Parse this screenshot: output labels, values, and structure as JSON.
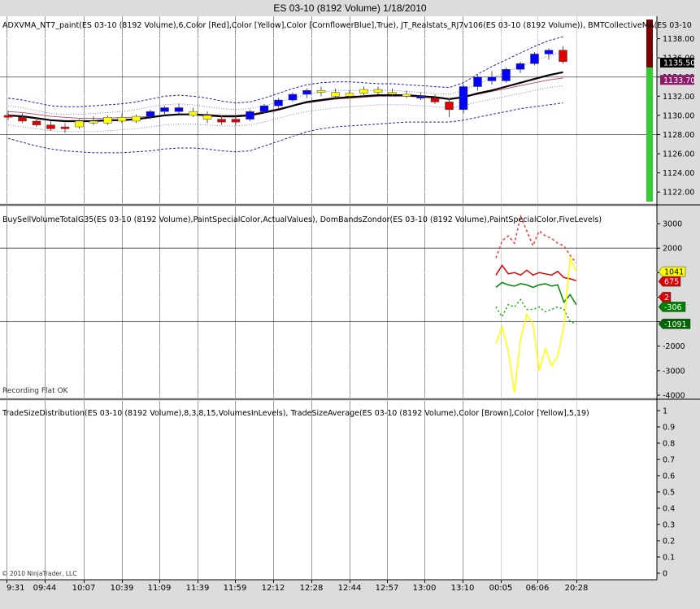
{
  "window": {
    "title": "ES 03-10 (8192 Volume)  1/18/2010"
  },
  "chart_data": [
    {
      "type": "candlestick",
      "panel": "price",
      "label": "ADXVMA_NT7_paint(ES 03-10 (8192 Volume),6,Color [Red],Color [Yellow],Color [CornflowerBlue],True), JT_Realstats_RJ7v106(ES 03-10 (8192 Volume)), BMTCollectiveMA(ES 03-10",
      "ylim": [
        1121,
        1140
      ],
      "yticks": [
        "1138.00",
        "1136.00",
        "1134.00",
        "1132.00",
        "1130.00",
        "1128.00",
        "1126.00",
        "1124.00",
        "1122.00"
      ],
      "price_tags": [
        {
          "text": "1135.50",
          "value": 1135.5,
          "bg": "#000000",
          "fg": "#ffffff"
        },
        {
          "text": "1133.70",
          "value": 1133.7,
          "bg": "#8b1a6b",
          "fg": "#ffffff"
        }
      ],
      "corner_value": "0",
      "candles": [
        {
          "o": 1130.0,
          "h": 1130.5,
          "l": 1129.5,
          "c": 1129.8,
          "color": "red"
        },
        {
          "o": 1129.8,
          "h": 1130.2,
          "l": 1129.2,
          "c": 1129.4,
          "color": "red"
        },
        {
          "o": 1129.4,
          "h": 1129.8,
          "l": 1128.8,
          "c": 1129.0,
          "color": "red"
        },
        {
          "o": 1129.0,
          "h": 1129.4,
          "l": 1128.4,
          "c": 1128.6,
          "color": "red"
        },
        {
          "o": 1128.6,
          "h": 1129.2,
          "l": 1128.2,
          "c": 1128.8,
          "color": "red"
        },
        {
          "o": 1128.8,
          "h": 1129.6,
          "l": 1128.6,
          "c": 1129.4,
          "color": "yellow"
        },
        {
          "o": 1129.4,
          "h": 1129.9,
          "l": 1129.0,
          "c": 1129.2,
          "color": "yellow"
        },
        {
          "o": 1129.2,
          "h": 1130.0,
          "l": 1129.0,
          "c": 1129.8,
          "color": "yellow"
        },
        {
          "o": 1129.8,
          "h": 1130.2,
          "l": 1129.2,
          "c": 1129.4,
          "color": "yellow"
        },
        {
          "o": 1129.4,
          "h": 1130.1,
          "l": 1129.2,
          "c": 1129.9,
          "color": "yellow"
        },
        {
          "o": 1129.9,
          "h": 1130.6,
          "l": 1129.6,
          "c": 1130.4,
          "color": "blue"
        },
        {
          "o": 1130.4,
          "h": 1131.0,
          "l": 1130.0,
          "c": 1130.8,
          "color": "blue"
        },
        {
          "o": 1130.8,
          "h": 1131.2,
          "l": 1130.2,
          "c": 1130.4,
          "color": "blue"
        },
        {
          "o": 1130.4,
          "h": 1130.8,
          "l": 1129.8,
          "c": 1130.0,
          "color": "yellow"
        },
        {
          "o": 1130.0,
          "h": 1130.4,
          "l": 1129.2,
          "c": 1129.6,
          "color": "yellow"
        },
        {
          "o": 1129.6,
          "h": 1130.0,
          "l": 1129.0,
          "c": 1129.3,
          "color": "red"
        },
        {
          "o": 1129.3,
          "h": 1129.9,
          "l": 1129.0,
          "c": 1129.6,
          "color": "red"
        },
        {
          "o": 1129.6,
          "h": 1130.6,
          "l": 1129.4,
          "c": 1130.4,
          "color": "blue"
        },
        {
          "o": 1130.4,
          "h": 1131.2,
          "l": 1130.2,
          "c": 1131.0,
          "color": "blue"
        },
        {
          "o": 1131.0,
          "h": 1131.8,
          "l": 1130.8,
          "c": 1131.6,
          "color": "blue"
        },
        {
          "o": 1131.6,
          "h": 1132.4,
          "l": 1131.4,
          "c": 1132.2,
          "color": "blue"
        },
        {
          "o": 1132.2,
          "h": 1132.8,
          "l": 1131.8,
          "c": 1132.6,
          "color": "blue"
        },
        {
          "o": 1132.6,
          "h": 1133.0,
          "l": 1132.0,
          "c": 1132.4,
          "color": "yellow"
        },
        {
          "o": 1132.4,
          "h": 1132.8,
          "l": 1131.8,
          "c": 1132.0,
          "color": "yellow"
        },
        {
          "o": 1132.0,
          "h": 1132.6,
          "l": 1131.8,
          "c": 1132.3,
          "color": "yellow"
        },
        {
          "o": 1132.3,
          "h": 1133.0,
          "l": 1132.0,
          "c": 1132.7,
          "color": "yellow"
        },
        {
          "o": 1132.7,
          "h": 1133.0,
          "l": 1132.2,
          "c": 1132.4,
          "color": "yellow"
        },
        {
          "o": 1132.4,
          "h": 1132.8,
          "l": 1132.0,
          "c": 1132.2,
          "color": "yellow"
        },
        {
          "o": 1132.2,
          "h": 1132.6,
          "l": 1131.8,
          "c": 1132.0,
          "color": "yellow"
        },
        {
          "o": 1132.0,
          "h": 1132.4,
          "l": 1131.6,
          "c": 1131.8,
          "color": "blue"
        },
        {
          "o": 1131.8,
          "h": 1132.2,
          "l": 1131.2,
          "c": 1131.4,
          "color": "red"
        },
        {
          "o": 1131.4,
          "h": 1131.8,
          "l": 1129.8,
          "c": 1130.6,
          "color": "red"
        },
        {
          "o": 1130.6,
          "h": 1133.2,
          "l": 1130.2,
          "c": 1133.0,
          "color": "blue"
        },
        {
          "o": 1133.0,
          "h": 1134.2,
          "l": 1132.6,
          "c": 1134.0,
          "color": "blue"
        },
        {
          "o": 1134.0,
          "h": 1134.6,
          "l": 1133.2,
          "c": 1133.6,
          "color": "blue"
        },
        {
          "o": 1133.6,
          "h": 1135.0,
          "l": 1133.4,
          "c": 1134.8,
          "color": "blue"
        },
        {
          "o": 1134.8,
          "h": 1135.6,
          "l": 1134.4,
          "c": 1135.4,
          "color": "blue"
        },
        {
          "o": 1135.4,
          "h": 1136.6,
          "l": 1135.2,
          "c": 1136.4,
          "color": "blue"
        },
        {
          "o": 1136.4,
          "h": 1137.0,
          "l": 1135.8,
          "c": 1136.8,
          "color": "blue"
        },
        {
          "o": 1136.8,
          "h": 1137.2,
          "l": 1135.4,
          "c": 1135.6,
          "color": "red"
        }
      ],
      "ma_black": [
        1130.0,
        1129.9,
        1129.7,
        1129.5,
        1129.4,
        1129.4,
        1129.4,
        1129.5,
        1129.5,
        1129.6,
        1129.8,
        1130.0,
        1130.1,
        1130.1,
        1130.0,
        1129.9,
        1129.9,
        1130.0,
        1130.3,
        1130.6,
        1131.0,
        1131.4,
        1131.6,
        1131.8,
        1131.9,
        1132.0,
        1132.1,
        1132.1,
        1132.1,
        1132.0,
        1131.9,
        1131.7,
        1131.9,
        1132.3,
        1132.6,
        1133.0,
        1133.4,
        1133.8,
        1134.2,
        1134.5
      ],
      "ma_red": [
        1130.4,
        1130.3,
        1130.1,
        1129.9,
        1129.8,
        1129.7,
        1129.7,
        1129.7,
        1129.8,
        1129.8,
        1129.9,
        1130.0,
        1130.1,
        1130.1,
        1130.1,
        1130.0,
        1130.0,
        1130.1,
        1130.4,
        1130.7,
        1131.0,
        1131.3,
        1131.5,
        1131.7,
        1131.8,
        1131.9,
        1132.0,
        1132.0,
        1132.0,
        1131.9,
        1131.8,
        1131.7,
        1131.9,
        1132.2,
        1132.5,
        1132.8,
        1133.1,
        1133.4,
        1133.7,
        1133.9
      ],
      "band_upper": [
        1131.8,
        1131.6,
        1131.3,
        1131.0,
        1130.9,
        1130.9,
        1131.0,
        1131.1,
        1131.2,
        1131.4,
        1131.7,
        1132.0,
        1132.1,
        1132.0,
        1131.8,
        1131.5,
        1131.3,
        1131.4,
        1131.8,
        1132.3,
        1132.8,
        1133.2,
        1133.4,
        1133.5,
        1133.5,
        1133.4,
        1133.3,
        1133.3,
        1133.2,
        1133.1,
        1133.0,
        1132.9,
        1133.4,
        1134.3,
        1135.1,
        1135.8,
        1136.5,
        1137.2,
        1137.8,
        1138.2
      ],
      "band_mid_upper": [
        1131.0,
        1130.8,
        1130.5,
        1130.2,
        1130.1,
        1130.1,
        1130.2,
        1130.3,
        1130.4,
        1130.6,
        1130.9,
        1131.1,
        1131.2,
        1131.1,
        1130.9,
        1130.7,
        1130.6,
        1130.7,
        1131.0,
        1131.4,
        1131.8,
        1132.2,
        1132.4,
        1132.6,
        1132.6,
        1132.6,
        1132.6,
        1132.6,
        1132.5,
        1132.4,
        1132.3,
        1132.2,
        1132.6,
        1133.3,
        1133.9,
        1134.5,
        1135.1,
        1135.7,
        1136.2,
        1136.6
      ],
      "band_mid_lower": [
        1129.0,
        1128.8,
        1128.6,
        1128.4,
        1128.3,
        1128.3,
        1128.3,
        1128.4,
        1128.5,
        1128.6,
        1128.8,
        1129.0,
        1129.1,
        1129.1,
        1129.0,
        1128.9,
        1128.9,
        1129.0,
        1129.3,
        1129.7,
        1130.1,
        1130.4,
        1130.6,
        1130.8,
        1130.9,
        1131.0,
        1131.1,
        1131.1,
        1131.1,
        1131.0,
        1130.9,
        1130.8,
        1131.0,
        1131.4,
        1131.7,
        1132.0,
        1132.3,
        1132.6,
        1132.9,
        1133.1
      ],
      "band_lower": [
        1127.6,
        1127.2,
        1126.8,
        1126.5,
        1126.3,
        1126.2,
        1126.1,
        1126.1,
        1126.1,
        1126.2,
        1126.3,
        1126.5,
        1126.6,
        1126.6,
        1126.5,
        1126.3,
        1126.2,
        1126.3,
        1126.8,
        1127.3,
        1127.8,
        1128.3,
        1128.6,
        1128.8,
        1128.9,
        1129.0,
        1129.1,
        1129.2,
        1129.3,
        1129.3,
        1129.3,
        1129.3,
        1129.5,
        1129.8,
        1130.1,
        1130.4,
        1130.7,
        1130.9,
        1131.1,
        1131.3
      ],
      "volume_bar": {
        "green_from": 1121,
        "green_to": 1135,
        "darkred_from": 1135,
        "darkred_to": 1140
      }
    },
    {
      "type": "line",
      "panel": "volume",
      "label": "BuySellVolumeTotalG35(ES 03-10 (8192 Volume),PaintSpecialColor,ActualValues), DomBandsZondor(ES 03-10 (8192 Volume),PaintSpecialColor,FiveLevels)",
      "status_text": "Recording Flat OK",
      "ylim": [
        -4100,
        3500
      ],
      "yticks": [
        "3000",
        "2000",
        "1000",
        "0",
        "-1000",
        "-2000",
        "-3000",
        "-4000"
      ],
      "ytick_values": [
        3000,
        2000,
        1000,
        0,
        -1000,
        -2000,
        -3000,
        -4000
      ],
      "value_tags": [
        {
          "text": "1041",
          "value": 1041,
          "bg": "#ffff00",
          "fg": "#000000"
        },
        {
          "text": "675",
          "value": 675,
          "bg": "#dd0000",
          "fg": "#ffffff"
        },
        {
          "text": "2",
          "value": 2,
          "bg": "#dd0000",
          "fg": "#ffffff"
        },
        {
          "text": "-306",
          "value": -306,
          "bg": "#008000",
          "fg": "#ffffff"
        },
        {
          "text": "-1091",
          "value": -1091,
          "bg": "#006400",
          "fg": "#ffffff"
        }
      ],
      "x_start_index": 32,
      "series": [
        {
          "color": "#ff3030",
          "dash": "3,3",
          "values": [
            1600,
            2300,
            2500,
            2200,
            3300,
            2700,
            2100,
            2700,
            2500,
            2400,
            2200,
            2100,
            1700,
            1400
          ]
        },
        {
          "color": "#e00000",
          "dash": "",
          "values": [
            900,
            1300,
            950,
            1000,
            900,
            1100,
            900,
            1000,
            950,
            900,
            1050,
            800,
            750,
            675
          ]
        },
        {
          "color": "#008800",
          "dash": "",
          "values": [
            400,
            600,
            500,
            450,
            550,
            500,
            400,
            500,
            550,
            450,
            500,
            -200,
            100,
            -306
          ]
        },
        {
          "color": "#00aa00",
          "dash": "2,3",
          "values": [
            -400,
            -800,
            -300,
            -400,
            -100,
            -500,
            -500,
            -400,
            -600,
            -500,
            -400,
            -500,
            -1000,
            -1091
          ]
        },
        {
          "color": "#ffff00",
          "dash": "",
          "values": [
            -1900,
            -1200,
            -2200,
            -3900,
            -1700,
            -700,
            -1100,
            -3000,
            -2100,
            -2800,
            -2400,
            -1200,
            1600,
            1041
          ]
        }
      ]
    },
    {
      "type": "line",
      "panel": "tradesize",
      "label": "TradeSizeDistribution(ES 03-10 (8192 Volume),8,3,8,15,VolumesInLevels),  TradeSizeAverage(ES 03-10 (8192 Volume),Color [Brown],Color [Yellow],5,19)",
      "copyright": "© 2010 NinjaTrader, LLC",
      "ylim": [
        0,
        1
      ],
      "yticks": [
        "1",
        "0.9",
        "0.8",
        "0.7",
        "0.6",
        "0.5",
        "0.4",
        "0.3",
        "0.2",
        "0.1",
        "0"
      ],
      "ytick_values": [
        1,
        0.9,
        0.8,
        0.7,
        0.6,
        0.5,
        0.4,
        0.3,
        0.2,
        0.1,
        0
      ]
    }
  ],
  "x_axis": {
    "labels": [
      "9:31",
      "09:44",
      "10:07",
      "10:39",
      "11:09",
      "11:39",
      "11:59",
      "12:12",
      "12:28",
      "12:44",
      "12:57",
      "13:00",
      "13:10",
      "00:05",
      "06:06",
      "20:28"
    ],
    "label_x": [
      8,
      55,
      103,
      150,
      196,
      243,
      289,
      336,
      383,
      430,
      476,
      522,
      569,
      616,
      661,
      709
    ]
  }
}
